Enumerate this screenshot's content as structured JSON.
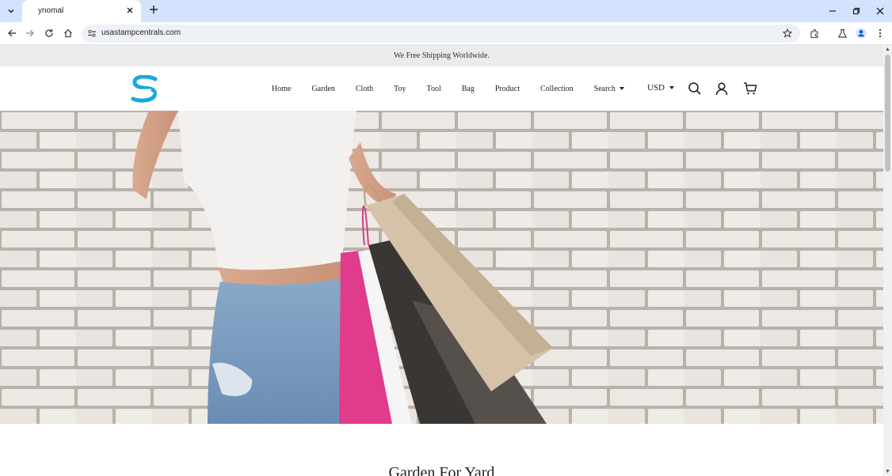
{
  "browser": {
    "tab_title": "ynomal",
    "url": "usastampcentrals.com"
  },
  "announcement": "We Free Shipping Worldwide.",
  "nav": {
    "items": [
      "Home",
      "Garden",
      "Cloth",
      "Toy",
      "Tool",
      "Bag",
      "Product",
      "Collection"
    ],
    "search_label": "Search",
    "currency": "USD"
  },
  "section": {
    "title": "Garden For Yard"
  },
  "colors": {
    "logo_blue": "#19a7de",
    "announce_bg": "#ebebeb",
    "brick": "#ece8e3",
    "mortar": "#b9b2ab"
  },
  "icons": [
    "search-icon",
    "account-icon",
    "cart-icon"
  ]
}
